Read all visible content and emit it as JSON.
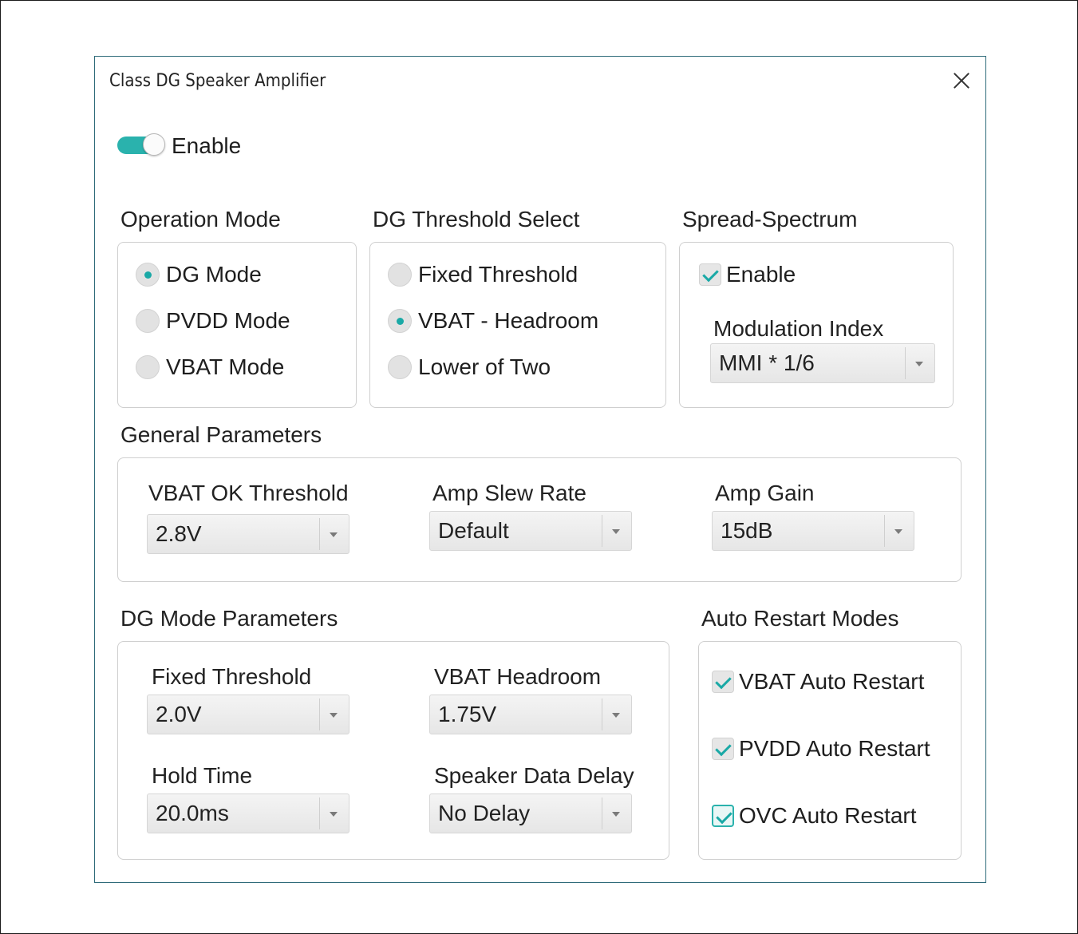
{
  "window": {
    "title": "Class DG Speaker Amplifier"
  },
  "enable_toggle": {
    "label": "Enable",
    "on": true
  },
  "operation_mode": {
    "title": "Operation Mode",
    "options": [
      "DG Mode",
      "PVDD Mode",
      "VBAT Mode"
    ],
    "selected": "DG Mode"
  },
  "dg_threshold": {
    "title": "DG Threshold Select",
    "options": [
      "Fixed Threshold",
      "VBAT - Headroom",
      "Lower of Two"
    ],
    "selected": "VBAT - Headroom"
  },
  "spread_spectrum": {
    "title": "Spread-Spectrum",
    "enable_label": "Enable",
    "enable_checked": true,
    "modulation_label": "Modulation Index",
    "modulation_value": "MMI * 1/6"
  },
  "general": {
    "title": "General Parameters",
    "vbat_ok": {
      "label": "VBAT OK Threshold",
      "value": "2.8V"
    },
    "slew": {
      "label": "Amp Slew Rate",
      "value": "Default"
    },
    "gain": {
      "label": "Amp Gain",
      "value": "15dB"
    }
  },
  "dg_params": {
    "title": "DG Mode Parameters",
    "fixed_threshold": {
      "label": "Fixed Threshold",
      "value": "2.0V"
    },
    "vbat_headroom": {
      "label": "VBAT Headroom",
      "value": "1.75V"
    },
    "hold_time": {
      "label": "Hold Time",
      "value": "20.0ms"
    },
    "speaker_delay": {
      "label": "Speaker Data Delay",
      "value": "No Delay"
    }
  },
  "auto_restart": {
    "title": "Auto Restart Modes",
    "items": [
      {
        "label": "VBAT Auto Restart",
        "checked": true
      },
      {
        "label": "PVDD Auto Restart",
        "checked": true
      },
      {
        "label": "OVC Auto Restart",
        "checked": true
      }
    ]
  },
  "colors": {
    "accent": "#2ab2ad",
    "window_border": "#2f6b7a"
  }
}
